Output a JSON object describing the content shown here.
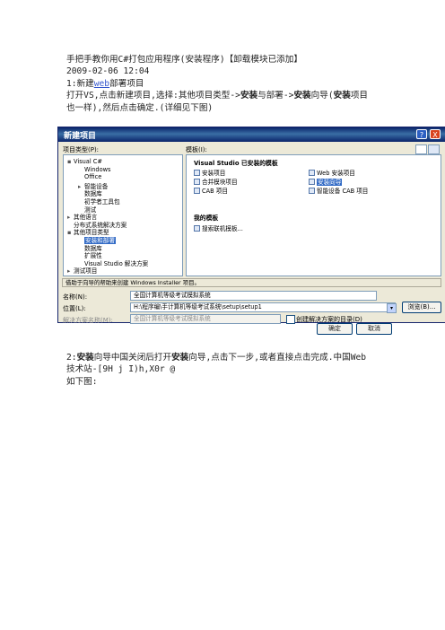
{
  "doc": {
    "title": "手把手教你用C#打包应用程序(安装程序)【卸载模块已添加】",
    "date": "2009-02-06 12:04",
    "step1_prefix": "1:新建",
    "step1_link": "web",
    "step1_suffix": "部署项目",
    "step1_a": "打开VS,点击新建项目,选择:其他项目类型->",
    "step1_b": "安装",
    "step1_c": "与部署->",
    "step1_d": "安装",
    "step1_e": "向导(",
    "step1_f": "安装",
    "step1_g": "项目",
    "step1_line3": "也一样),然后点击确定.(详细见下图)",
    "step2_a": "2:",
    "step2_b": "安装",
    "step2_c": "向导中国关闭后打开",
    "step2_d": "安装",
    "step2_e": "向导,点击下一步,或者直接点击完成.中国Web",
    "step2_line2": "技术站-[9H j I)h,X0r @",
    "step2_line3": "如下图:"
  },
  "dialog": {
    "title": "新建项目",
    "help_btn": "?",
    "close_btn": "X",
    "project_types_label": "项目类型(P):",
    "templates_label": "模板(I):",
    "tree": [
      {
        "label": "Visual C#",
        "depth": 0,
        "toggle": "▪"
      },
      {
        "label": "Windows",
        "depth": 1,
        "toggle": ""
      },
      {
        "label": "Office",
        "depth": 1,
        "toggle": ""
      },
      {
        "label": "智能设备",
        "depth": 1,
        "toggle": "▸"
      },
      {
        "label": "数据库",
        "depth": 1,
        "toggle": ""
      },
      {
        "label": "初学者工具包",
        "depth": 1,
        "toggle": ""
      },
      {
        "label": "测试",
        "depth": 1,
        "toggle": ""
      },
      {
        "label": "其他语言",
        "depth": 0,
        "toggle": "▸"
      },
      {
        "label": "分布式系统解决方案",
        "depth": 0,
        "toggle": ""
      },
      {
        "label": "其他项目类型",
        "depth": 0,
        "toggle": "▪"
      },
      {
        "label": "安装和部署",
        "depth": 1,
        "toggle": "",
        "selected": true
      },
      {
        "label": "数据库",
        "depth": 1,
        "toggle": ""
      },
      {
        "label": "扩展性",
        "depth": 1,
        "toggle": ""
      },
      {
        "label": "Visual Studio 解决方案",
        "depth": 1,
        "toggle": ""
      },
      {
        "label": "测试项目",
        "depth": 0,
        "toggle": "▸"
      }
    ],
    "installed_header": "Visual Studio 已安装的模板",
    "templates": [
      {
        "label": "安装项目",
        "col": 0,
        "row": 0
      },
      {
        "label": "Web 安装项目",
        "col": 1,
        "row": 0
      },
      {
        "label": "合并模块项目",
        "col": 0,
        "row": 1
      },
      {
        "label": "安装向导",
        "col": 1,
        "row": 1,
        "selected": true
      },
      {
        "label": "CAB 项目",
        "col": 0,
        "row": 2
      },
      {
        "label": "智能设备 CAB 项目",
        "col": 1,
        "row": 2
      }
    ],
    "my_header": "我的模板",
    "search_online": "搜索联机模板...",
    "status": "借助于向导的帮助来创建 Windows Installer 项目。",
    "name_label": "名称(N):",
    "name_value": "全国计算机等级考试模拟系统",
    "location_label": "位置(L):",
    "location_value": "H:\\程序编\\手计算机等级考试系统\\setup\\setup1",
    "browse_btn": "浏览(B)...",
    "solution_label": "解决方案名称(M):",
    "solution_value": "全国计算机等级考试模拟系统",
    "create_dir_label": "创建解决方案的目录(D)",
    "ok_btn": "确定",
    "cancel_btn": "取消"
  }
}
